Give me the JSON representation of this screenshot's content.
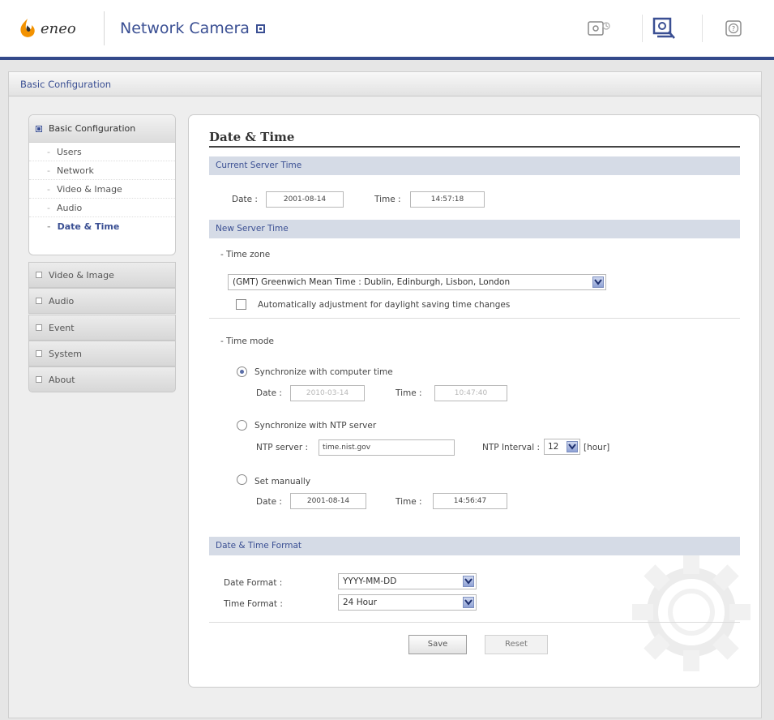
{
  "header": {
    "logo_text": "eneo",
    "product_title": "Network Camera",
    "icons": [
      "live-view-icon",
      "setup-icon",
      "help-icon"
    ]
  },
  "breadcrumb": "Basic Configuration",
  "sidebar": {
    "group_title": "Basic Configuration",
    "sub_items": [
      {
        "label": "Users"
      },
      {
        "label": "Network"
      },
      {
        "label": "Video & Image"
      },
      {
        "label": "Audio"
      },
      {
        "label": "Date & Time",
        "active": true
      }
    ],
    "items": [
      {
        "label": "Video & Image"
      },
      {
        "label": "Audio"
      },
      {
        "label": "Event"
      },
      {
        "label": "System"
      },
      {
        "label": "About"
      }
    ]
  },
  "page": {
    "title": "Date & Time",
    "current": {
      "header": "Current Server Time",
      "date_label": "Date :",
      "date_value": "2001-08-14",
      "time_label": "Time :",
      "time_value": "14:57:18"
    },
    "new": {
      "header": "New Server Time",
      "timezone_label": "- Time zone",
      "timezone_value": "(GMT) Greenwich Mean Time : Dublin, Edinburgh, Lisbon, London",
      "dst_label": "Automatically adjustment for daylight saving time changes",
      "mode_label": "- Time mode",
      "sync_pc_label": "Synchronize with computer time",
      "sync_pc_date_label": "Date :",
      "sync_pc_date": "2010-03-14",
      "sync_pc_time_label": "Time :",
      "sync_pc_time": "10:47:40",
      "sync_ntp_label": "Synchronize with NTP server",
      "ntp_server_label": "NTP server :",
      "ntp_server_value": "time.nist.gov",
      "ntp_interval_label": "NTP Interval :",
      "ntp_interval_value": "12",
      "ntp_interval_unit": "[hour]",
      "manual_label": "Set manually",
      "manual_date_label": "Date :",
      "manual_date": "2001-08-14",
      "manual_time_label": "Time :",
      "manual_time": "14:56:47"
    },
    "format": {
      "header": "Date & Time Format",
      "date_format_label": "Date Format :",
      "date_format_value": "YYYY-MM-DD",
      "time_format_label": "Time Format :",
      "time_format_value": "24 Hour"
    },
    "buttons": {
      "save": "Save",
      "reset": "Reset"
    }
  }
}
